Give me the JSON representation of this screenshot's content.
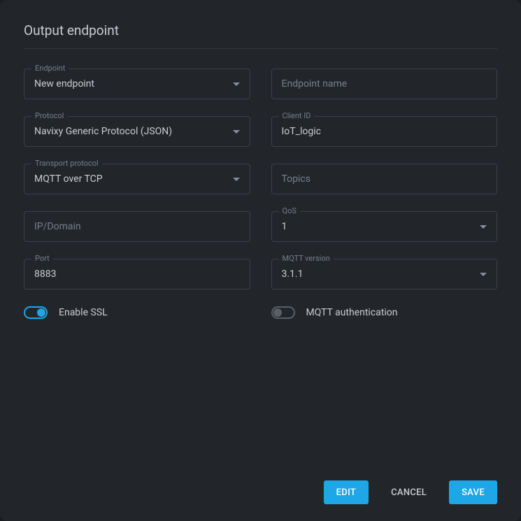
{
  "title": "Output endpoint",
  "left": {
    "endpoint": {
      "label": "Endpoint",
      "value": "New endpoint"
    },
    "protocol": {
      "label": "Protocol",
      "value": "Navixy Generic Protocol (JSON)"
    },
    "transport": {
      "label": "Transport protocol",
      "value": "MQTT over TCP"
    },
    "ip_domain": {
      "placeholder": "IP/Domain"
    },
    "port": {
      "label": "Port",
      "value": "8883"
    },
    "enable_ssl": {
      "label": "Enable SSL",
      "value": true
    }
  },
  "right": {
    "endpoint_name": {
      "placeholder": "Endpoint name"
    },
    "client_id": {
      "label": "Client ID",
      "value": "IoT_logic"
    },
    "topics": {
      "placeholder": "Topics"
    },
    "qos": {
      "label": "QoS",
      "value": "1"
    },
    "mqtt_version": {
      "label": "MQTT version",
      "value": "3.1.1"
    },
    "mqtt_auth": {
      "label": "MQTT authentication",
      "value": false
    }
  },
  "buttons": {
    "edit": "EDIT",
    "cancel": "CANCEL",
    "save": "SAVE"
  }
}
